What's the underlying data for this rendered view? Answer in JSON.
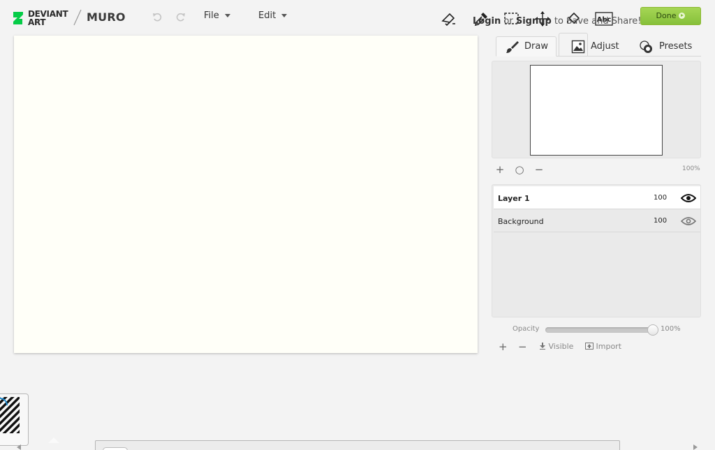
{
  "brand": {
    "logo_line1": "DEVIANT",
    "logo_line2": "ART",
    "app_name": "MURO",
    "accent_color": "#05cc47"
  },
  "toolbar": {
    "undo_icon": "undo-icon",
    "redo_icon": "redo-icon",
    "menus": [
      {
        "label": "File"
      },
      {
        "label": "Edit"
      }
    ],
    "tools": [
      "brush-tool-icon",
      "eyedropper-tool-icon",
      "selection-tool-icon",
      "move-tool-icon",
      "fill-tool-icon",
      "text-tool-icon"
    ],
    "text_tool_glyph": "Abc"
  },
  "login_message": {
    "login": "Login",
    "or": "or",
    "signup": "Signup",
    "rest": "to Save and Share!"
  },
  "done_button": {
    "label": "Done",
    "color": "#94c947"
  },
  "panel": {
    "tabs": [
      {
        "label": "Draw",
        "icon": "brush-icon",
        "active": true
      },
      {
        "label": "Adjust",
        "icon": "image-adjust-icon",
        "active": false
      },
      {
        "label": "Presets",
        "icon": "presets-icon",
        "active": false
      }
    ]
  },
  "navigator": {
    "zoom_in": "+",
    "zoom_reset": "○",
    "zoom_out": "−",
    "zoom_level": "100%"
  },
  "layers": [
    {
      "name": "Layer 1",
      "opacity": "100",
      "selected": true,
      "visible_icon": "eye-icon"
    },
    {
      "name": "Background",
      "opacity": "100",
      "selected": false,
      "visible_icon": "eye-icon"
    }
  ],
  "opacity": {
    "label": "Opacity",
    "value": 1.0,
    "value_text": "100%"
  },
  "layer_actions": {
    "add": "+",
    "remove": "−",
    "visible": "Visible",
    "import": "Import"
  }
}
